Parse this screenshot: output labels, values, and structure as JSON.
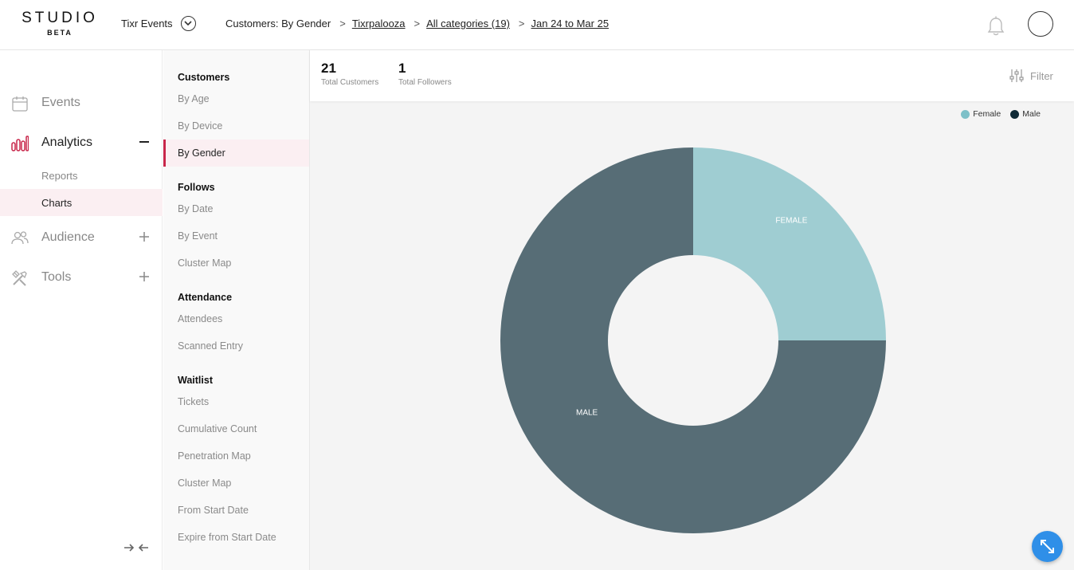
{
  "header": {
    "logo_main": "STUDIO",
    "logo_sub": "BETA",
    "org_name": "Tixr Events",
    "breadcrumbs": [
      "Customers: By Gender",
      "Tixrpalooza",
      "All categories (19)",
      "Jan 24 to Mar 25"
    ],
    "separator": ">"
  },
  "nav": {
    "items": [
      {
        "label": "Events",
        "icon": "calendar-icon"
      },
      {
        "label": "Analytics",
        "icon": "bar-chart-icon",
        "expanded": true,
        "children": [
          "Reports",
          "Charts"
        ],
        "active_child": "Charts"
      },
      {
        "label": "Audience",
        "icon": "people-icon"
      },
      {
        "label": "Tools",
        "icon": "tools-icon"
      }
    ]
  },
  "menu": {
    "sections": [
      {
        "title": "Customers",
        "items": [
          "By Age",
          "By Device",
          "By Gender"
        ]
      },
      {
        "title": "Follows",
        "items": [
          "By Date",
          "By Event",
          "Cluster Map"
        ]
      },
      {
        "title": "Attendance",
        "items": [
          "Attendees",
          "Scanned Entry"
        ]
      },
      {
        "title": "Waitlist",
        "items": [
          "Tickets",
          "Cumulative Count",
          "Penetration Map",
          "Cluster Map",
          "From Start Date",
          "Expire from Start Date"
        ]
      }
    ],
    "active_item": "By Gender"
  },
  "stats": {
    "total_customers": "21",
    "total_customers_label": "Total Customers",
    "total_followers": "1",
    "total_followers_label": "Total Followers"
  },
  "filter_label": "Filter",
  "colors": {
    "accent": "#c8264a",
    "female": "#9fcdd2",
    "male": "#576d76",
    "fab": "#2f8fe8"
  },
  "chart_data": {
    "type": "pie",
    "style": "donut",
    "categories": [
      "Female",
      "Male"
    ],
    "values": [
      25,
      75
    ],
    "slice_labels": [
      "FEMALE",
      "MALE"
    ],
    "legend": [
      "Female",
      "Male"
    ],
    "legend_colors": [
      "#7dc0c8",
      "#0f2a36"
    ],
    "legend_position": "top-right"
  }
}
